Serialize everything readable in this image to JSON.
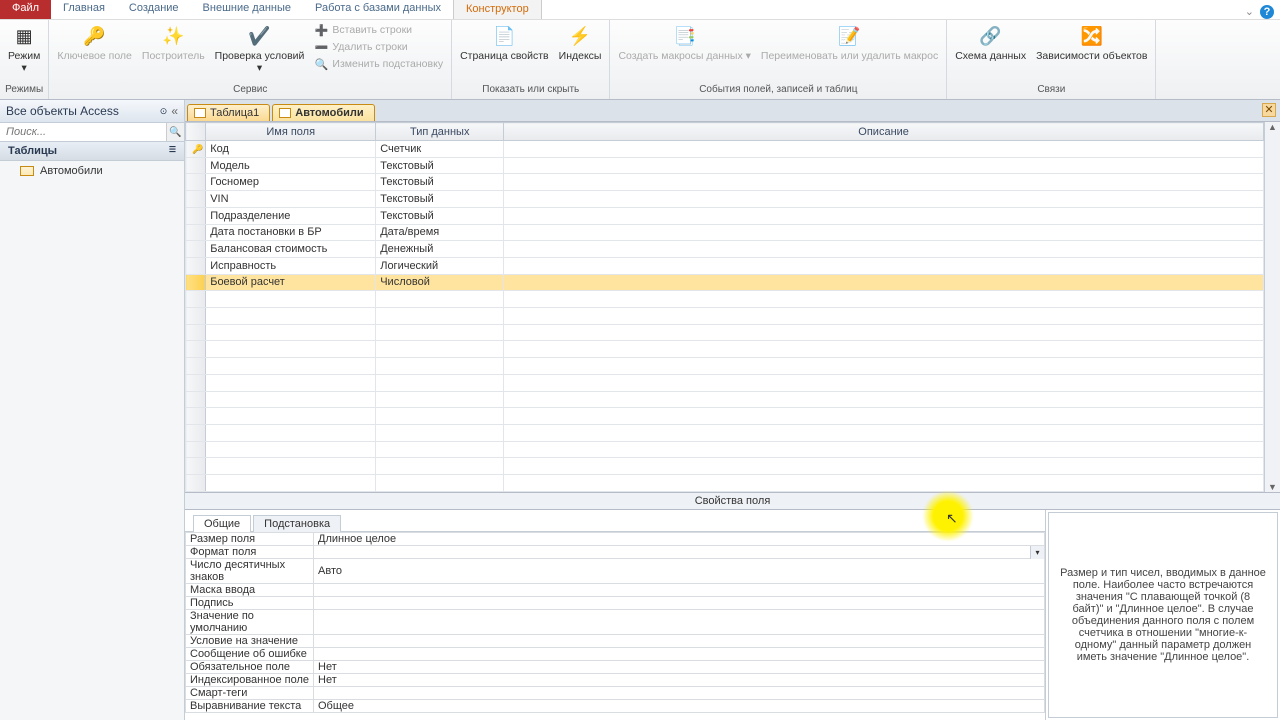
{
  "ribbon": {
    "file": "Файл",
    "tabs": [
      "Главная",
      "Создание",
      "Внешние данные",
      "Работа с базами данных",
      "Конструктор"
    ],
    "active_tab": 4,
    "groups": {
      "modes": {
        "mode": "Режим",
        "label": "Режимы"
      },
      "tools": {
        "key_field": "Ключевое поле",
        "builder": "Построитель",
        "test_rules": "Проверка условий",
        "insert_rows": "Вставить строки",
        "delete_rows": "Удалить строки",
        "modify_lookup": "Изменить подстановку",
        "label": "Сервис"
      },
      "showhide": {
        "prop_sheet": "Страница свойств",
        "indexes": "Индексы",
        "label": "Показать или скрыть"
      },
      "macros": {
        "create": "Создать макросы данных ▾",
        "rename": "Переименовать или удалить макрос",
        "label": "События полей, записей и таблиц"
      },
      "relations": {
        "schema": "Схема данных",
        "deps": "Зависимости объектов",
        "label": "Связи"
      }
    }
  },
  "nav": {
    "header": "Все объекты Access",
    "search_placeholder": "Поиск...",
    "group": "Таблицы",
    "items": [
      "Автомобили"
    ]
  },
  "docs": {
    "tabs": [
      "Таблица1",
      "Автомобили"
    ],
    "active": 1
  },
  "grid": {
    "cols": {
      "name": "Имя поля",
      "type": "Тип данных",
      "desc": "Описание"
    },
    "rows": [
      {
        "name": "Код",
        "type": "Счетчик",
        "pk": true
      },
      {
        "name": "Модель",
        "type": "Текстовый"
      },
      {
        "name": "Госномер",
        "type": "Текстовый"
      },
      {
        "name": "VIN",
        "type": "Текстовый"
      },
      {
        "name": "Подразделение",
        "type": "Текстовый"
      },
      {
        "name": "Дата постановки в БР",
        "type": "Дата/время"
      },
      {
        "name": "Балансовая стоимость",
        "type": "Денежный"
      },
      {
        "name": "Исправность",
        "type": "Логический"
      },
      {
        "name": "Боевой расчет",
        "type": "Числовой",
        "current": true
      }
    ]
  },
  "props": {
    "header": "Свойства поля",
    "tabs": [
      "Общие",
      "Подстановка"
    ],
    "rows": [
      {
        "n": "Размер поля",
        "v": "Длинное целое"
      },
      {
        "n": "Формат поля",
        "v": ""
      },
      {
        "n": "Число десятичных знаков",
        "v": "Авто"
      },
      {
        "n": "Маска ввода",
        "v": ""
      },
      {
        "n": "Подпись",
        "v": ""
      },
      {
        "n": "Значение по умолчанию",
        "v": ""
      },
      {
        "n": "Условие на значение",
        "v": ""
      },
      {
        "n": "Сообщение об ошибке",
        "v": ""
      },
      {
        "n": "Обязательное поле",
        "v": "Нет"
      },
      {
        "n": "Индексированное поле",
        "v": "Нет"
      },
      {
        "n": "Смарт-теги",
        "v": ""
      },
      {
        "n": "Выравнивание текста",
        "v": "Общее"
      }
    ],
    "help": "Размер и тип чисел, вводимых в данное поле. Наиболее часто встречаются значения \"С плавающей точкой (8 байт)\" и \"Длинное целое\". В случае объединения данного поля с полем счетчика в отношении \"многие-к-одному\" данный параметр должен иметь значение \"Длинное целое\"."
  }
}
